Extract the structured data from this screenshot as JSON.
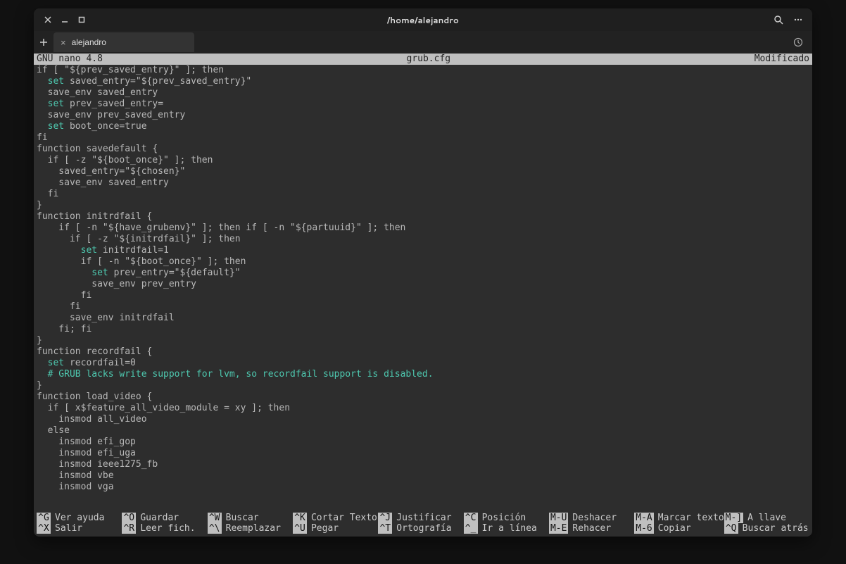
{
  "titlebar": {
    "title": "/home/alejandro"
  },
  "tab": {
    "label": "alejandro"
  },
  "status": {
    "left": "  GNU nano 4.8",
    "center": "grub.cfg",
    "right": "Modificado  "
  },
  "code": {
    "lines": [
      {
        "t": "if [ \"${prev_saved_entry}\" ]; then",
        "k": false,
        "i": 0
      },
      {
        "t": "set saved_entry=\"${prev_saved_entry}\"",
        "k": true,
        "i": 1
      },
      {
        "t": "save_env saved_entry",
        "k": false,
        "i": 1
      },
      {
        "t": "set prev_saved_entry=",
        "k": true,
        "i": 1
      },
      {
        "t": "save_env prev_saved_entry",
        "k": false,
        "i": 1
      },
      {
        "t": "set boot_once=true",
        "k": true,
        "i": 1
      },
      {
        "t": "fi",
        "k": false,
        "i": 0
      },
      {
        "t": "",
        "k": false,
        "i": 0
      },
      {
        "t": "function savedefault {",
        "k": false,
        "i": 0
      },
      {
        "t": "if [ -z \"${boot_once}\" ]; then",
        "k": false,
        "i": 1
      },
      {
        "t": "saved_entry=\"${chosen}\"",
        "k": false,
        "i": 2
      },
      {
        "t": "save_env saved_entry",
        "k": false,
        "i": 2
      },
      {
        "t": "fi",
        "k": false,
        "i": 1
      },
      {
        "t": "}",
        "k": false,
        "i": 0
      },
      {
        "t": "function initrdfail {",
        "k": false,
        "i": 0
      },
      {
        "t": "if [ -n \"${have_grubenv}\" ]; then if [ -n \"${partuuid}\" ]; then",
        "k": false,
        "i": 2
      },
      {
        "t": "if [ -z \"${initrdfail}\" ]; then",
        "k": false,
        "i": 3
      },
      {
        "t": "set initrdfail=1",
        "k": true,
        "i": 4
      },
      {
        "t": "if [ -n \"${boot_once}\" ]; then",
        "k": false,
        "i": 4
      },
      {
        "t": "set prev_entry=\"${default}\"",
        "k": true,
        "i": 5
      },
      {
        "t": "save_env prev_entry",
        "k": false,
        "i": 5
      },
      {
        "t": "fi",
        "k": false,
        "i": 4
      },
      {
        "t": "fi",
        "k": false,
        "i": 3
      },
      {
        "t": "save_env initrdfail",
        "k": false,
        "i": 3
      },
      {
        "t": "fi; fi",
        "k": false,
        "i": 2
      },
      {
        "t": "}",
        "k": false,
        "i": 0
      },
      {
        "t": "function recordfail {",
        "k": false,
        "i": 0
      },
      {
        "t": "set recordfail=0",
        "k": true,
        "i": 1
      },
      {
        "t": "# GRUB lacks write support for lvm, so recordfail support is disabled.",
        "k": false,
        "i": 1,
        "c": true
      },
      {
        "t": "}",
        "k": false,
        "i": 0
      },
      {
        "t": "function load_video {",
        "k": false,
        "i": 0
      },
      {
        "t": "if [ x$feature_all_video_module = xy ]; then",
        "k": false,
        "i": 1
      },
      {
        "t": "insmod all_video",
        "k": false,
        "i": 2
      },
      {
        "t": "else",
        "k": false,
        "i": 1
      },
      {
        "t": "insmod efi_gop",
        "k": false,
        "i": 2
      },
      {
        "t": "insmod efi_uga",
        "k": false,
        "i": 2
      },
      {
        "t": "insmod ieee1275_fb",
        "k": false,
        "i": 2
      },
      {
        "t": "insmod vbe",
        "k": false,
        "i": 2
      },
      {
        "t": "insmod vga",
        "k": false,
        "i": 2
      }
    ]
  },
  "shortcuts": [
    [
      {
        "key": "^G",
        "label": "Ver ayuda"
      },
      {
        "key": "^O",
        "label": "Guardar"
      },
      {
        "key": "^W",
        "label": "Buscar"
      },
      {
        "key": "^K",
        "label": "Cortar Texto"
      },
      {
        "key": "^J",
        "label": "Justificar"
      },
      {
        "key": "^C",
        "label": "Posición"
      },
      {
        "key": "M-U",
        "label": "Deshacer"
      },
      {
        "key": "M-A",
        "label": "Marcar texto"
      },
      {
        "key": "M-]",
        "label": "A llave"
      }
    ],
    [
      {
        "key": "^X",
        "label": "Salir"
      },
      {
        "key": "^R",
        "label": "Leer fich."
      },
      {
        "key": "^\\",
        "label": "Reemplazar"
      },
      {
        "key": "^U",
        "label": "Pegar"
      },
      {
        "key": "^T",
        "label": "Ortografía"
      },
      {
        "key": "^_",
        "label": "Ir a línea"
      },
      {
        "key": "M-E",
        "label": "Rehacer"
      },
      {
        "key": "M-6",
        "label": "Copiar"
      },
      {
        "key": "^Q",
        "label": "Buscar atrás"
      }
    ]
  ]
}
